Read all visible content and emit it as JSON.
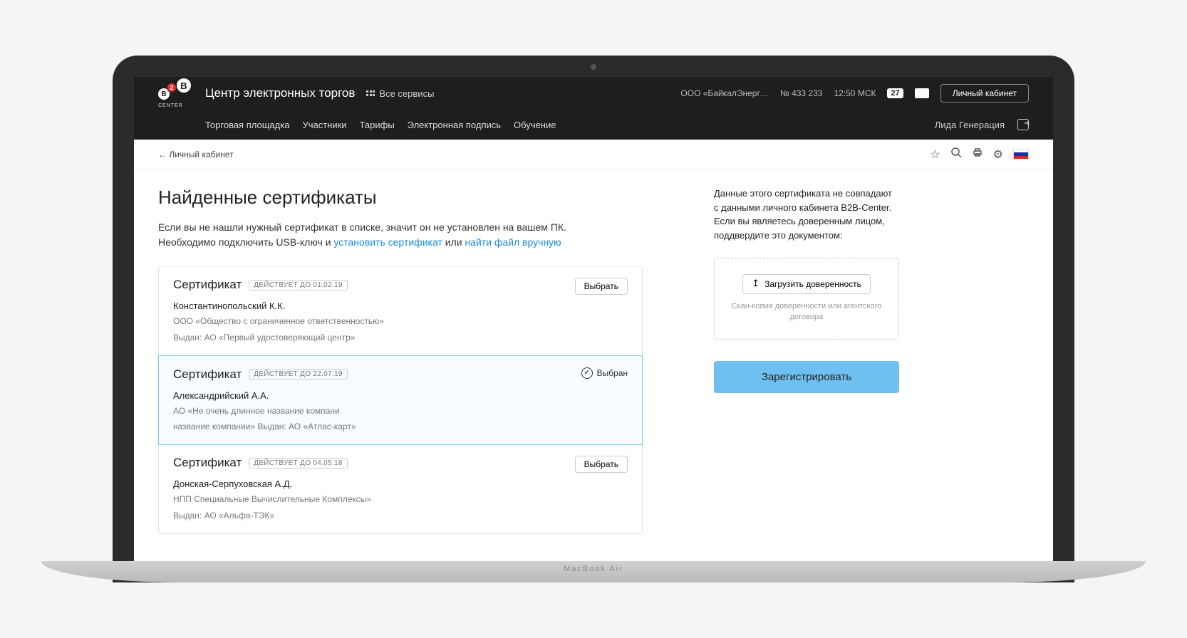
{
  "header": {
    "logo_text": "CENTER",
    "logo_badge": "2",
    "brand": "Центр электронных торгов",
    "all_services": "Все сервисы",
    "org": "ООО «БайкалЭнерг…",
    "order_no": "№ 433 233",
    "time": "12:50 МСК",
    "badge_day": "27",
    "cabinet_button": "Личный кабинет",
    "nav": [
      "Торговая площадка",
      "Участники",
      "Тарифы",
      "Электронная подпись",
      "Обучение"
    ],
    "user": "Лида Генерация"
  },
  "breadcrumb": {
    "back": "← Личный кабинет"
  },
  "page": {
    "title": "Найденные сертификаты",
    "intro_1": "Если вы не нашли нужный сертификат в списке, значит он не установлен на вашем ПК.",
    "intro_2a": "Необходимо подключить USB-ключ и ",
    "intro_link1": "установить сертификат",
    "intro_2b": " или ",
    "intro_link2": "найти файл вручную"
  },
  "certs": [
    {
      "title": "Сертификат",
      "badge": "ДЕЙСТВУЕТ ДО 01.02.19",
      "action": "Выбрать",
      "selected": false,
      "person": "Константинопольский К.К.",
      "org": "ООО «Общество с ограниченное ответственностью»",
      "issued": "Выдан: АО «Первый удостоверяющий центр»"
    },
    {
      "title": "Сертификат",
      "badge": "ДЕЙСТВУЕТ ДО 22.07.19",
      "action": "Выбран",
      "selected": true,
      "person": "Александрийский А.А.",
      "org": "АО «Не очень длинное название компани",
      "issued": "название компании» Выдан:  АО «Атлас-карт»"
    },
    {
      "title": "Сертификат",
      "badge": "ДЕЙСТВУЕТ ДО 04.05.18",
      "action": "Выбрать",
      "selected": false,
      "person": "Донская-Серпуховская А.Д.",
      "org": "НПП Специальные Вычислительные Комплексы»",
      "issued": "Выдан:  АО «Альфа-ТЭК»"
    }
  ],
  "right": {
    "text": "Данные этого сертификата не совпадают с данными личного кабинета B2B-Center. Если вы являетесь доверенным лицом, поддвердите это документом:",
    "upload_btn": "Загрузить доверенность",
    "upload_hint": "Скан-копия доверенности или агентского договора",
    "register_btn": "Зарегистрировать"
  },
  "laptop_label": "MacBook Air"
}
